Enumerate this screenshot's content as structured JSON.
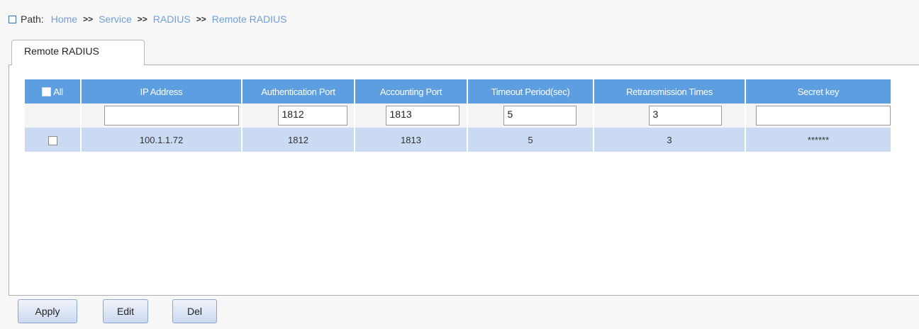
{
  "path": {
    "label": "Path:",
    "crumbs": [
      "Home",
      "Service",
      "RADIUS",
      "Remote RADIUS"
    ],
    "separator": ">>"
  },
  "tab": {
    "label": "Remote RADIUS"
  },
  "table": {
    "headers": {
      "all": "All",
      "ip": "IP Address",
      "auth_port": "Authentication Port",
      "acct_port": "Accounting Port",
      "timeout": "Timeout Period(sec)",
      "retrans": "Retransmission Times",
      "secret": "Secret key"
    },
    "inputs": {
      "ip": "",
      "auth_port": "1812",
      "acct_port": "1813",
      "timeout": "5",
      "retrans": "3",
      "secret": ""
    },
    "rows": [
      {
        "ip": "100.1.1.72",
        "auth_port": "1812",
        "acct_port": "1813",
        "timeout": "5",
        "retrans": "3",
        "secret": "******"
      }
    ]
  },
  "buttons": {
    "apply": "Apply",
    "edit": "Edit",
    "del": "Del"
  },
  "colors": {
    "header_bg": "#5d9ee0",
    "row_bg": "#cadaf3",
    "link": "#6f9fd6"
  }
}
